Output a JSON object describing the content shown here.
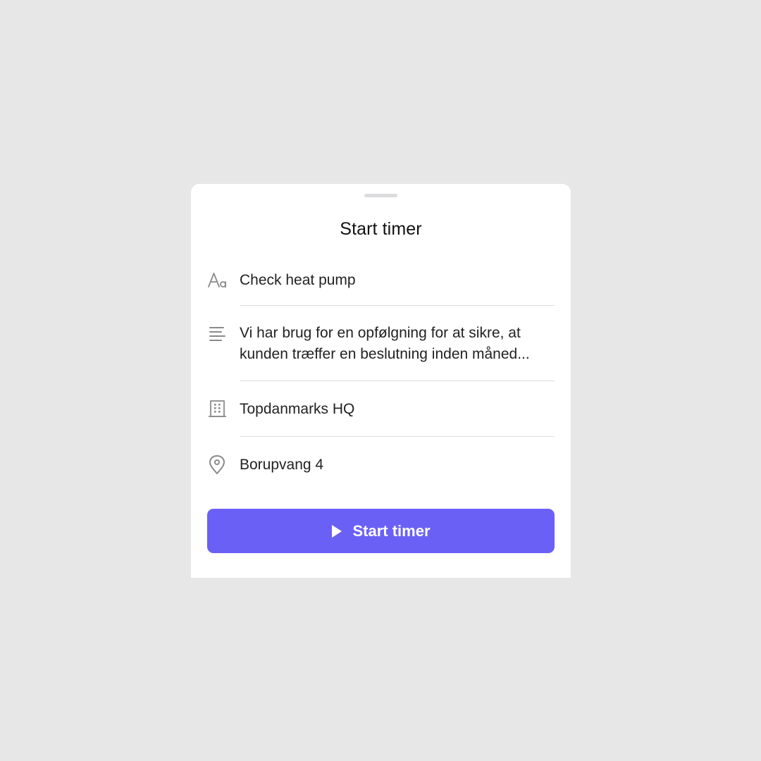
{
  "sheet": {
    "title": "Start timer"
  },
  "fields": {
    "name": {
      "icon": "text-format-icon",
      "value": "Check heat pump"
    },
    "description": {
      "icon": "align-left-icon",
      "value": "Vi har brug for en opfølgning for at sikre, at kunden træffer en beslutning inden måned..."
    },
    "company": {
      "icon": "building-icon",
      "value": "Topdanmarks HQ"
    },
    "address": {
      "icon": "location-pin-icon",
      "value": "Borupvang 4"
    }
  },
  "actions": {
    "start_label": "Start timer",
    "start_icon": "play-icon"
  },
  "colors": {
    "accent": "#6b60f6",
    "background": "#e7e7e7",
    "icon": "#8a8a8a"
  }
}
